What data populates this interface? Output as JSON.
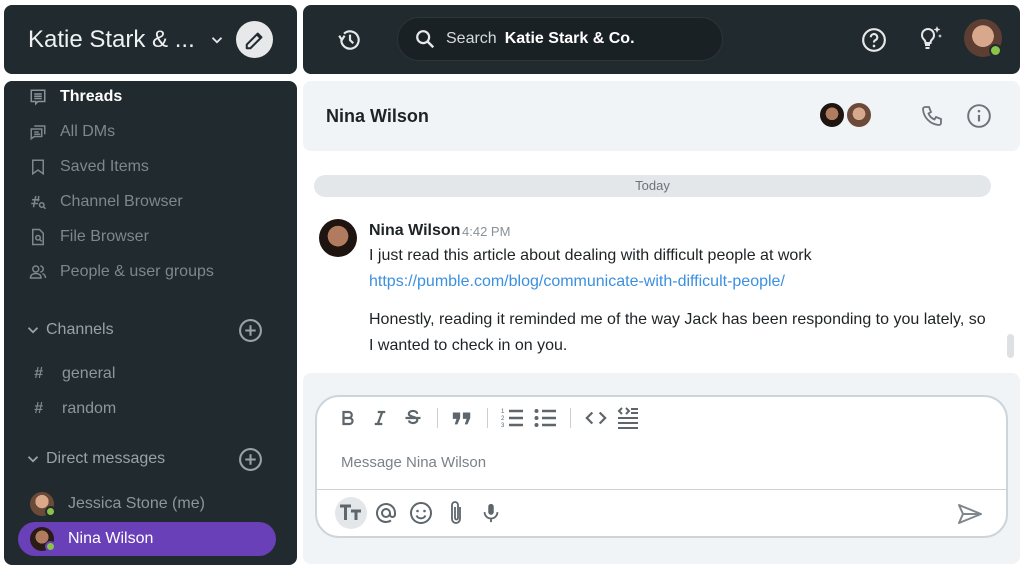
{
  "workspace": {
    "name": "Katie Stark & ...",
    "compose_icon": "pencil-icon"
  },
  "sidebar": {
    "nav": [
      {
        "label": "Threads",
        "icon": "threads-icon",
        "active": true
      },
      {
        "label": "All DMs",
        "icon": "all-dms-icon"
      },
      {
        "label": "Saved Items",
        "icon": "bookmark-icon"
      },
      {
        "label": "Channel Browser",
        "icon": "channel-browser-icon"
      },
      {
        "label": "File Browser",
        "icon": "file-browser-icon"
      },
      {
        "label": "People & user groups",
        "icon": "people-icon"
      }
    ],
    "channels_label": "Channels",
    "channels": [
      {
        "label": "general"
      },
      {
        "label": "random"
      }
    ],
    "dms_label": "Direct messages",
    "dms": [
      {
        "label": "Jessica Stone (me)",
        "status": "online"
      },
      {
        "label": "Nina Wilson",
        "status": "online",
        "active": true
      }
    ],
    "hash": "#"
  },
  "topbar": {
    "search_label": "Search",
    "search_workspace": "Katie Stark & Co."
  },
  "chat": {
    "title": "Nina Wilson",
    "day_divider": "Today",
    "message": {
      "author": "Nina Wilson",
      "time": "4:42 PM",
      "line1": "I just read this article about dealing with difficult people at work",
      "link": "https://pumble.com/blog/communicate-with-difficult-people/",
      "line2": "Honestly, reading it reminded me of the way Jack has been responding to you lately, so",
      "line3": "I wanted to check in on you."
    }
  },
  "composer": {
    "placeholder": "Message Nina Wilson",
    "format_buttons": [
      "bold",
      "italic",
      "strikethrough",
      "quote",
      "ordered-list",
      "bullet-list",
      "code",
      "code-block"
    ],
    "bottom_buttons": [
      "text-format",
      "mention",
      "emoji",
      "attach",
      "microphone",
      "send"
    ]
  },
  "colors": {
    "sidebar_bg": "#212a2f",
    "accent": "#6940b8",
    "online": "#8bc34a",
    "link": "#3b8fe0"
  }
}
